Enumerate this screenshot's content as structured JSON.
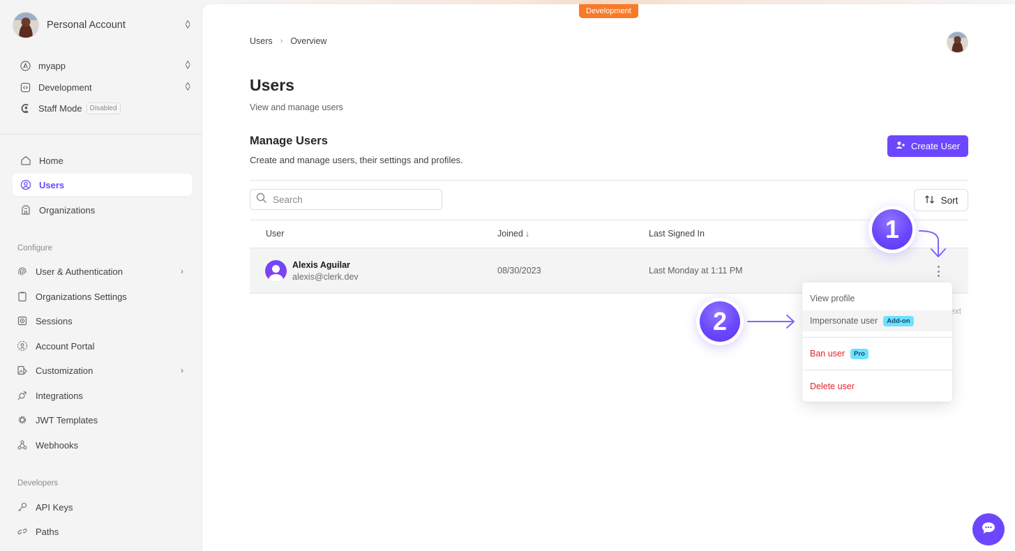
{
  "sidebar": {
    "account": {
      "name": "Personal Account",
      "avatar_icon": "user-photo"
    },
    "app": {
      "label": "myapp",
      "icon": "app-logo-icon"
    },
    "environment": {
      "label": "Development",
      "icon": "code-icon"
    },
    "staff_mode": {
      "label": "Staff Mode",
      "badge": "Disabled",
      "icon": "staff-icon"
    },
    "main_items": [
      {
        "label": "Home",
        "icon": "home-icon",
        "active": false
      },
      {
        "label": "Users",
        "icon": "user-circle-icon",
        "active": true
      },
      {
        "label": "Organizations",
        "icon": "building-icon",
        "active": false
      }
    ],
    "configure_label": "Configure",
    "configure_items": [
      {
        "label": "User & Authentication",
        "icon": "fingerprint-icon",
        "has_chevron": true
      },
      {
        "label": "Organizations Settings",
        "icon": "clipboard-icon",
        "has_chevron": false
      },
      {
        "label": "Sessions",
        "icon": "sessions-icon",
        "has_chevron": false
      },
      {
        "label": "Account Portal",
        "icon": "account-portal-icon",
        "has_chevron": false
      },
      {
        "label": "Customization",
        "icon": "customization-icon",
        "has_chevron": true
      },
      {
        "label": "Integrations",
        "icon": "plug-icon",
        "has_chevron": false
      },
      {
        "label": "JWT Templates",
        "icon": "gear-icon",
        "has_chevron": false
      },
      {
        "label": "Webhooks",
        "icon": "webhook-icon",
        "has_chevron": false
      }
    ],
    "developers_label": "Developers",
    "developer_items": [
      {
        "label": "API Keys",
        "icon": "key-icon"
      },
      {
        "label": "Paths",
        "icon": "link-icon"
      }
    ]
  },
  "header": {
    "environment_badge": "Development",
    "breadcrumb": [
      "Users",
      "Overview"
    ],
    "breadcrumb_separator": "›"
  },
  "page": {
    "title": "Users",
    "subtitle": "View and manage users",
    "section_title": "Manage Users",
    "section_subtitle": "Create and manage users, their settings and profiles.",
    "create_button": "Create User",
    "search_placeholder": "Search",
    "sort_button": "Sort"
  },
  "table": {
    "columns": [
      {
        "label": "User",
        "sort": ""
      },
      {
        "label": "Joined",
        "sort": "↓"
      },
      {
        "label": "Last Signed In",
        "sort": ""
      }
    ],
    "rows": [
      {
        "name": "Alexis Aguilar",
        "email": "alexis@clerk.dev",
        "joined": "08/30/2023",
        "last_signed_in": "Last Monday at 1:11 PM"
      }
    ],
    "pagination_ghost": "ext"
  },
  "context_menu": {
    "items": [
      {
        "label": "View profile",
        "badge": "",
        "danger": false
      },
      {
        "label": "Impersonate user",
        "badge": "Add-on",
        "danger": false
      },
      {
        "label": "Ban user",
        "badge": "Pro",
        "danger": true
      },
      {
        "label": "Delete user",
        "badge": "",
        "danger": true
      }
    ]
  },
  "annotations": {
    "steps": [
      "1",
      "2"
    ],
    "accent": "#6c47ff"
  },
  "colors": {
    "accent": "#6c47ff",
    "env_badge": "#f77b2a",
    "danger": "#e5242b",
    "pill": "#6fe0ff"
  }
}
